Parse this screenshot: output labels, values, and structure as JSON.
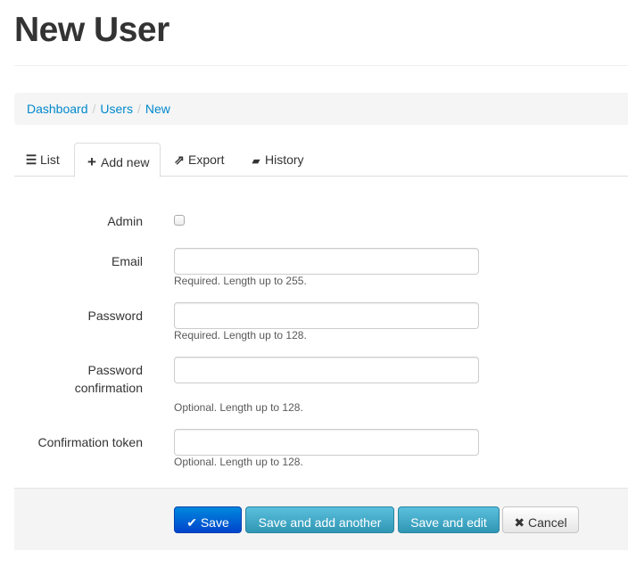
{
  "page": {
    "title": "New User"
  },
  "breadcrumb": {
    "items": [
      "Dashboard",
      "Users",
      "New"
    ],
    "separator": "/"
  },
  "tabs": [
    {
      "label": "List",
      "icon": "list-icon",
      "glyph": "☰",
      "active": false
    },
    {
      "label": "Add new",
      "icon": "plus-icon",
      "glyph": "+",
      "active": true
    },
    {
      "label": "Export",
      "icon": "share-icon",
      "glyph": "⇗",
      "active": false
    },
    {
      "label": "History",
      "icon": "book-icon",
      "glyph": "▰",
      "active": false
    }
  ],
  "form": {
    "admin": {
      "label": "Admin",
      "checked": false
    },
    "email": {
      "label": "Email",
      "value": "",
      "help": "Required. Length up to 255."
    },
    "password": {
      "label": "Password",
      "value": "",
      "help": "Required. Length up to 128."
    },
    "password_confirmation": {
      "label_line1": "Password",
      "label_line2": "confirmation",
      "value": "",
      "help": "Optional. Length up to 128."
    },
    "confirmation_token": {
      "label": "Confirmation token",
      "value": "",
      "help": "Optional. Length up to 128."
    }
  },
  "actions": {
    "save": {
      "label": "Save",
      "glyph": "✔"
    },
    "save_add_another": {
      "label": "Save and add another"
    },
    "save_edit": {
      "label": "Save and edit"
    },
    "cancel": {
      "label": "Cancel",
      "glyph": "✖"
    }
  },
  "colors": {
    "link": "#0088cc",
    "primary": "#0055cc",
    "info": "#49afcd"
  }
}
